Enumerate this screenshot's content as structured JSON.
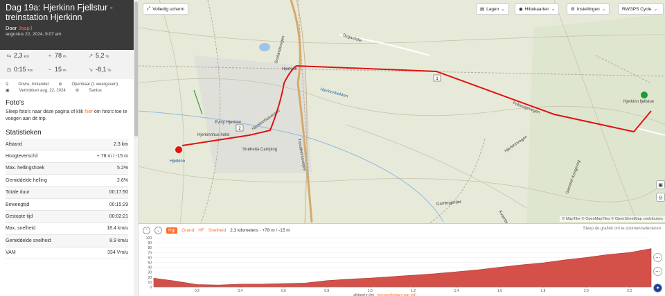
{
  "title": "Dag 19a: Hjerkinn Fjellstur - treinstation Hjerkinn",
  "byline": {
    "prefix": "Door",
    "author": "JaapJ"
  },
  "date": "augustus 22, 2024, 9:07 am",
  "summary": {
    "distance": {
      "value": "2,3",
      "unit": "km"
    },
    "gain": {
      "value": "78",
      "unit": "m"
    },
    "max_grade": {
      "value": "5,2",
      "unit": "%"
    },
    "moving_time": {
      "value": "0:15",
      "unit": "hrs"
    },
    "loss": {
      "value": "15",
      "unit": "m"
    },
    "min_grade": {
      "value": "-8,1",
      "unit": "%"
    }
  },
  "meta": {
    "location": "Dovre, Innlandet",
    "visibility": "Openbaar (1 weergaven)",
    "departed": "Vertrokken aug. 22, 2024",
    "vehicle": "Santos"
  },
  "photos": {
    "heading": "Foto's",
    "text_before": "Sleep foto's naar deze pagina of klik",
    "link": "hier",
    "text_after": "om foto's toe te voegen aan dit trip."
  },
  "stats": {
    "heading": "Statistieken",
    "rows": [
      {
        "label": "Afstand",
        "value": "2.3 km"
      },
      {
        "label": "Hoogteverschil",
        "value": "+ 78 m / -15 m"
      },
      {
        "label": "Max. hellingshoek",
        "value": "5.2%"
      },
      {
        "label": "Gemiddelde helling",
        "value": "2.6%"
      },
      {
        "label": "Totale duur",
        "value": "00:17:50"
      },
      {
        "label": "Beweegtijd",
        "value": "00:15:29"
      },
      {
        "label": "Gestopte tijd",
        "value": "00:02:21"
      },
      {
        "label": "Max. snelheid",
        "value": "18.4 km/u"
      },
      {
        "label": "Gemiddelde snelheid",
        "value": "8.9 km/u"
      },
      {
        "label": "VAM",
        "value": "334 Vm/u"
      }
    ]
  },
  "map_toolbar": {
    "fullscreen": "Volledig scherm",
    "layers": "Lagen",
    "heatmaps": "Hittekaarten",
    "settings": "Instellingen",
    "basemap": "RWGPS Cycle"
  },
  "map_labels": {
    "hjerkinn_north": "Hjerkinn",
    "hjerkinn_station": "Hjerkinn",
    "eviny": "Eviny Hjerkinn",
    "hotel": "Hjerkinnhus hotel",
    "snohetta": "Snøhetta Camping",
    "fjellstue": "Hjerkinn fjellstue",
    "bygardslie": "Bygardslie",
    "sealandvegen": "Sealandsvegen",
    "hjerkinnhusvegen": "Hjerkinnhusvegen",
    "trondheimsvegen": "Trondheimsvegen",
    "hjerkinnbekken": "Hjerkinnbekken",
    "fokstugu": "Fokstugevegen",
    "hjerkinnvegen": "Hjerkinnvegen",
    "gammel_kongeveg": "Gammel Kongeveg",
    "gamlegjerdet": "Gamlegjerdet",
    "kvarnbekken": "Kvarnbekken",
    "marker1": "1",
    "marker2": "2"
  },
  "attribution": "© MapTiler © OpenMapTiles © OpenStreetMap contributors",
  "chart_toolbar": {
    "tabs": [
      "Hgt",
      "Grand",
      "HF",
      "Snelheid"
    ],
    "summary": "2,3 kilometers · +78 m / -15 m",
    "hint": "Sleep de grafiek om te zoomen/selecteren"
  },
  "chart_data": {
    "type": "area",
    "xlabel": "afstand in km",
    "x_axis_note": "(oversprekelaan naar rijd)",
    "ylim": [
      0,
      100
    ],
    "yticks": [
      "100",
      "90",
      "80",
      "70",
      "60",
      "50",
      "40",
      "30",
      "20",
      "10",
      "0"
    ],
    "xticks": [
      "0.2",
      "0.4",
      "0.6",
      "0.8",
      "1.0",
      "1.2",
      "1.4",
      "1.6",
      "1.8",
      "2.0",
      "2.2"
    ],
    "x": [
      0,
      0.1,
      0.2,
      0.3,
      0.4,
      0.5,
      0.6,
      0.7,
      0.8,
      0.9,
      1.0,
      1.1,
      1.2,
      1.3,
      1.4,
      1.5,
      1.6,
      1.7,
      1.8,
      1.9,
      2.0,
      2.1,
      2.2,
      2.3
    ],
    "y": [
      18,
      12,
      5,
      4,
      6,
      6,
      7,
      8,
      13,
      16,
      18,
      21,
      24,
      27,
      31,
      35,
      40,
      45,
      49,
      55,
      60,
      66,
      70,
      78
    ],
    "color": "#d4514a"
  },
  "colors": {
    "accent": "#ff6b2b",
    "route": "#e01212",
    "header": "#3a3a3a"
  }
}
